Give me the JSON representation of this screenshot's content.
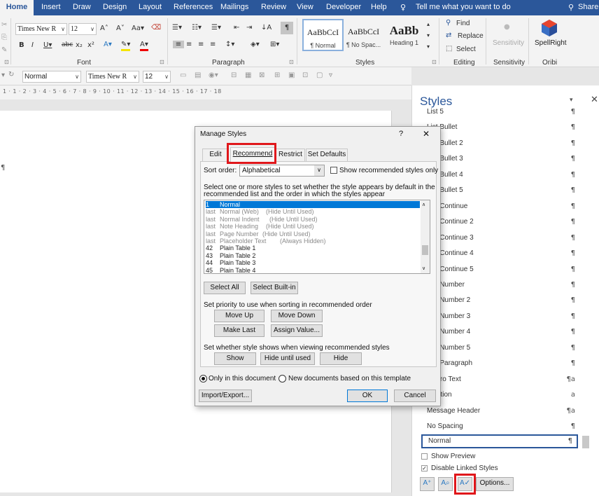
{
  "tabs": [
    "Home",
    "Insert",
    "Draw",
    "Design",
    "Layout",
    "References",
    "Mailings",
    "Review",
    "View",
    "Developer",
    "Help"
  ],
  "tell_me": "Tell me what you want to do",
  "share": "Share",
  "ribbon": {
    "font_name": "Times New R",
    "font_size": "12",
    "groups": {
      "font": "Font",
      "paragraph": "Paragraph",
      "styles": "Styles",
      "editing": "Editing",
      "sensitivity": "Sensitivity",
      "oribi": "Oribi"
    },
    "gallery": [
      {
        "preview": "AaBbCcI",
        "name": "¶ Normal"
      },
      {
        "preview": "AaBbCcI",
        "name": "¶ No Spac..."
      },
      {
        "preview": "AaBb",
        "name": "Heading 1"
      }
    ],
    "find": "Find",
    "replace": "Replace",
    "select": "Select",
    "sensitivity": "Sensitivity",
    "spellright": "SpellRight"
  },
  "qat": {
    "style": "Normal",
    "font": "Times New R",
    "size": "12"
  },
  "ruler": "1 · 1 · 2 · 3 · 4 · 5 · 6 · 7 · 8 · 9 · 10 · 11 · 12 · 13 · 14 · 15 · 16 · 17 · 18",
  "doc": {
    "pilcrow": "¶"
  },
  "styles_pane": {
    "title": "Styles",
    "items": [
      {
        "label": "List 5",
        "mark": "¶"
      },
      {
        "label": "List Bullet",
        "mark": "¶"
      },
      {
        "label": "List Bullet 2",
        "mark": "¶"
      },
      {
        "label": "List Bullet 3",
        "mark": "¶"
      },
      {
        "label": "List Bullet 4",
        "mark": "¶"
      },
      {
        "label": "List Bullet 5",
        "mark": "¶"
      },
      {
        "label": "List Continue",
        "mark": "¶"
      },
      {
        "label": "List Continue 2",
        "mark": "¶"
      },
      {
        "label": "List Continue 3",
        "mark": "¶"
      },
      {
        "label": "List Continue 4",
        "mark": "¶"
      },
      {
        "label": "List Continue 5",
        "mark": "¶"
      },
      {
        "label": "List Number",
        "mark": "¶"
      },
      {
        "label": "List Number 2",
        "mark": "¶"
      },
      {
        "label": "List Number 3",
        "mark": "¶"
      },
      {
        "label": "List Number 4",
        "mark": "¶"
      },
      {
        "label": "List Number 5",
        "mark": "¶"
      },
      {
        "label": "List Paragraph",
        "mark": "¶"
      },
      {
        "label": "Macro Text",
        "mark": "¶a"
      },
      {
        "label": "Mention",
        "mark": "a"
      },
      {
        "label": "Message Header",
        "mark": "¶a"
      },
      {
        "label": "No Spacing",
        "mark": "¶"
      },
      {
        "label": "Normal",
        "mark": "¶"
      }
    ],
    "show_preview": "Show Preview",
    "disable_linked": "Disable Linked Styles",
    "options": "Options..."
  },
  "dialog": {
    "title": "Manage Styles",
    "help": "?",
    "close": "✕",
    "tabs": [
      "Edit",
      "Recommend",
      "Restrict",
      "Set Defaults"
    ],
    "sort_label": "Sort order:",
    "sort_value": "Alphabetical",
    "show_recommended": "Show recommended styles only",
    "instruction_1": "Select one or more styles to set whether the style appears by default in the",
    "instruction_2": "recommended list and the order in which the styles appear",
    "list": [
      {
        "p": "1",
        "n": "Normal",
        "s": "",
        "sel": true,
        "gray": false
      },
      {
        "p": "last",
        "n": "Normal (Web)",
        "s": "(Hide Until Used)",
        "sel": false,
        "gray": true
      },
      {
        "p": "last",
        "n": "Normal Indent",
        "s": "(Hide Until Used)",
        "sel": false,
        "gray": true
      },
      {
        "p": "last",
        "n": "Note Heading",
        "s": "(Hide Until Used)",
        "sel": false,
        "gray": true
      },
      {
        "p": "last",
        "n": "Page Number",
        "s": "(Hide Until Used)",
        "sel": false,
        "gray": true
      },
      {
        "p": "last",
        "n": "Placeholder Text",
        "s": "(Always Hidden)",
        "sel": false,
        "gray": true
      },
      {
        "p": "42",
        "n": "Plain Table 1",
        "s": "",
        "sel": false,
        "gray": false
      },
      {
        "p": "43",
        "n": "Plain Table 2",
        "s": "",
        "sel": false,
        "gray": false
      },
      {
        "p": "44",
        "n": "Plain Table 3",
        "s": "",
        "sel": false,
        "gray": false
      },
      {
        "p": "45",
        "n": "Plain Table 4",
        "s": "",
        "sel": false,
        "gray": false
      }
    ],
    "select_all": "Select All",
    "select_builtin": "Select Built-in",
    "priority_label": "Set priority to use when sorting in recommended order",
    "move_up": "Move Up",
    "move_down": "Move Down",
    "make_last": "Make Last",
    "assign_value": "Assign Value...",
    "visibility_label": "Set whether style shows when viewing recommended styles",
    "show": "Show",
    "hide_until_used": "Hide until used",
    "hide": "Hide",
    "only_this_doc": "Only in this document",
    "new_docs": "New documents based on this template",
    "import_export": "Import/Export...",
    "ok": "OK",
    "cancel": "Cancel"
  },
  "colors": {
    "accent": "#2b579a",
    "highlight": "#e0171b",
    "selection": "#0078d7"
  }
}
